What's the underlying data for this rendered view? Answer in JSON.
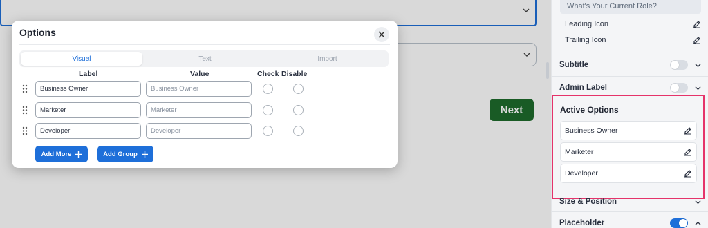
{
  "modal": {
    "title": "Options",
    "tabs": [
      {
        "label": "Visual",
        "active": true
      },
      {
        "label": "Text",
        "active": false
      },
      {
        "label": "Import",
        "active": false
      }
    ],
    "columns": {
      "label": "Label",
      "value": "Value",
      "check": "Check",
      "disable": "Disable"
    },
    "rows": [
      {
        "label": "Business Owner",
        "value": "Business Owner"
      },
      {
        "label": "Marketer",
        "value": "Marketer"
      },
      {
        "label": "Developer",
        "value": "Developer"
      }
    ],
    "add_more_label": "Add More",
    "add_group_label": "Add Group"
  },
  "background": {
    "next_label": "Next"
  },
  "panel": {
    "placeholder_text": "What's Your Current Role?",
    "leading_icon_label": "Leading Icon",
    "trailing_icon_label": "Trailing Icon",
    "subtitle_label": "Subtitle",
    "admin_label_label": "Admin Label",
    "active_options_title": "Active Options",
    "active_options": [
      "Business Owner",
      "Marketer",
      "Developer"
    ],
    "size_position_label": "Size & Position",
    "placeholder_label": "Placeholder",
    "subtitle_on": false,
    "admin_label_on": false,
    "placeholder_on": true
  },
  "colors": {
    "accent": "#1e6fd9",
    "next_button": "#1e6b2c",
    "highlight": "#e5336a"
  }
}
